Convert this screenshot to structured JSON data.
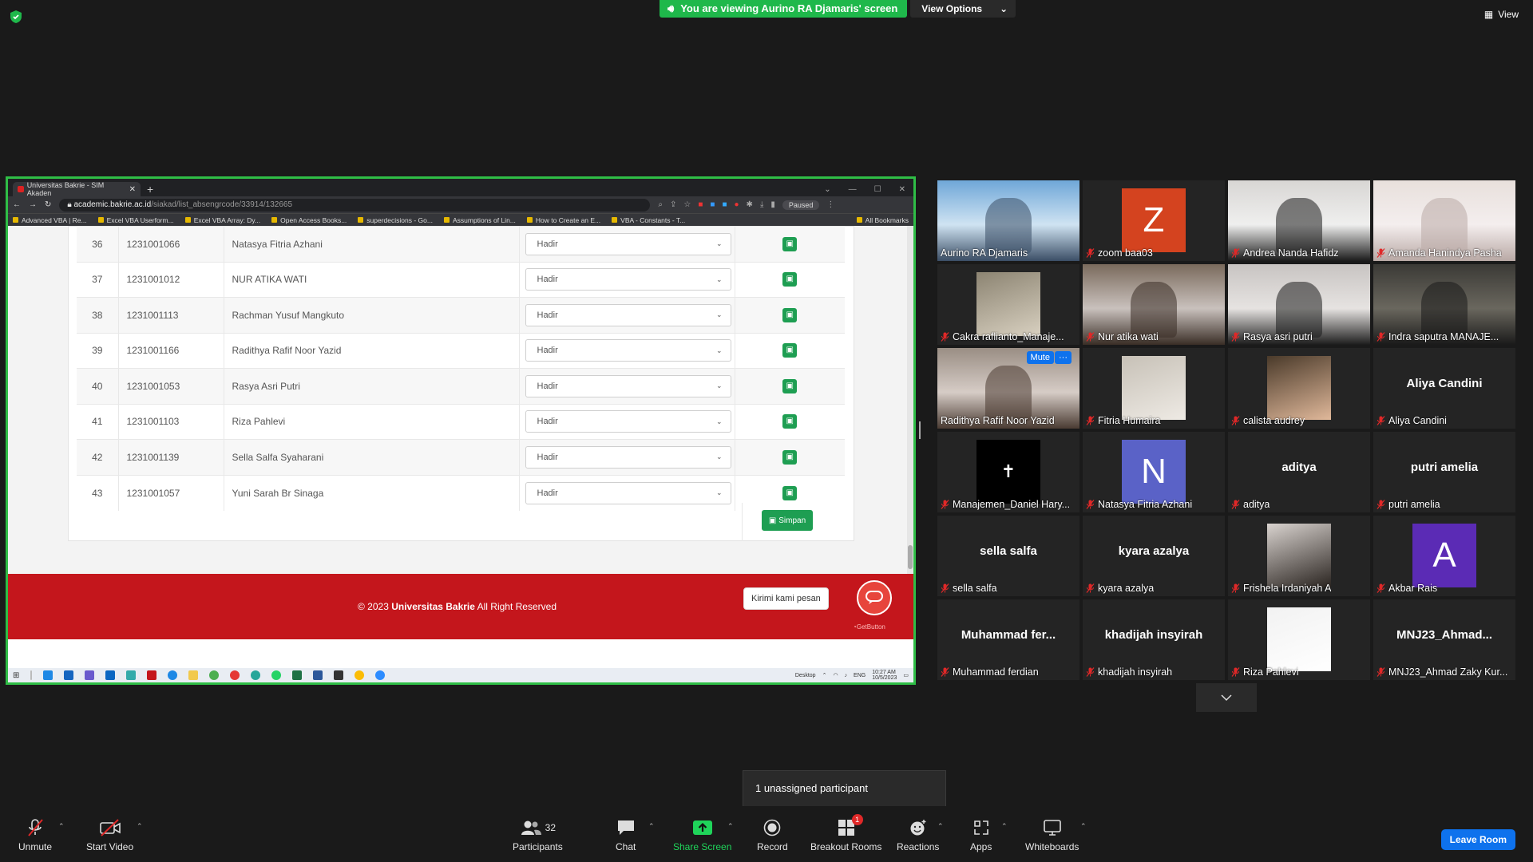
{
  "banner": {
    "viewing_text": "You are viewing Aurino RA Djamaris' screen",
    "view_options": "View Options",
    "view_label": "View"
  },
  "browser": {
    "tab_title": "Universitas Bakrie - SIM Akaden",
    "url_host": "academic.bakrie.ac.id",
    "url_path": "/siakad/list_absengrcode/33914/132665",
    "profile_status": "Paused",
    "bookmarks": [
      "Advanced VBA | Re...",
      "Excel VBA Userform...",
      "Excel VBA Array: Dy...",
      "Open Access Books...",
      "superdecisions - Go...",
      "Assumptions of Lin...",
      "How to Create an E...",
      "VBA - Constants - T..."
    ],
    "all_bookmarks": "All Bookmarks"
  },
  "attendance": {
    "rows": [
      {
        "no": "36",
        "nim": "1231001066",
        "name": "Natasya Fitria Azhani",
        "status": "Hadir"
      },
      {
        "no": "37",
        "nim": "1231001012",
        "name": "NUR ATIKA WATI",
        "status": "Hadir"
      },
      {
        "no": "38",
        "nim": "1231001113",
        "name": "Rachman Yusuf Mangkuto",
        "status": "Hadir"
      },
      {
        "no": "39",
        "nim": "1231001166",
        "name": "Radithya Rafif Noor Yazid",
        "status": "Hadir"
      },
      {
        "no": "40",
        "nim": "1231001053",
        "name": "Rasya Asri Putri",
        "status": "Hadir"
      },
      {
        "no": "41",
        "nim": "1231001103",
        "name": "Riza Pahlevi",
        "status": "Hadir"
      },
      {
        "no": "42",
        "nim": "1231001139",
        "name": "Sella Salfa Syaharani",
        "status": "Hadir"
      },
      {
        "no": "43",
        "nim": "1231001057",
        "name": "Yuni Sarah Br Sinaga",
        "status": "Hadir"
      }
    ],
    "save_all": "Simpan"
  },
  "footer": {
    "copyright_prefix": "© 2023",
    "university": "Universitas Bakrie",
    "rights": "All Right Reserved",
    "chat_prompt": "Kirimi kami pesan",
    "getbutton": "GetButton"
  },
  "taskbar": {
    "desktop": "Desktop",
    "lang": "ENG",
    "time": "10:27 AM",
    "date": "10/5/2023"
  },
  "participants": [
    {
      "name": "Aurino RA Djamaris",
      "kind": "photo",
      "colors": [
        "#6fa7d8",
        "#cfe3f2",
        "#3b4e66"
      ],
      "active": true,
      "muted": false
    },
    {
      "name": "zoom baa03",
      "kind": "letter",
      "letter": "Z",
      "color": "#d4431f",
      "muted": true
    },
    {
      "name": "Andrea Nanda Hafidz",
      "kind": "photo",
      "colors": [
        "#d8d6d4",
        "#efefee",
        "#1b1b1b"
      ],
      "muted": true
    },
    {
      "name": "Amanda Hanindya Pasha",
      "kind": "photo",
      "colors": [
        "#e8e0dc",
        "#f4eeee",
        "#b9a9a5"
      ],
      "muted": true
    },
    {
      "name": "Cakra raflianto_Manaje...",
      "kind": "small",
      "colors": [
        "#8c8472",
        "#d8d0c0"
      ],
      "muted": true
    },
    {
      "name": "Nur atika wati",
      "kind": "photo",
      "colors": [
        "#7a6a5c",
        "#c9c1bd",
        "#3a2e26"
      ],
      "muted": true
    },
    {
      "name": "Rasya asri putri",
      "kind": "photo",
      "colors": [
        "#c8c4c2",
        "#e6e3e1",
        "#1c1c1c"
      ],
      "muted": true
    },
    {
      "name": "Indra saputra MANAJE...",
      "kind": "photo",
      "colors": [
        "#3b3a36",
        "#6a675e",
        "#1a1a1a"
      ],
      "muted": true
    },
    {
      "name": "Radithya Rafif Noor Yazid",
      "kind": "photo",
      "colors": [
        "#9a8e84",
        "#d6ccc6",
        "#4a3b32"
      ],
      "muted": false,
      "hover": true,
      "mute_label": "Mute",
      "more_label": "···"
    },
    {
      "name": "Fitria Humaira",
      "kind": "small",
      "colors": [
        "#c7c1b7",
        "#eeeae4"
      ],
      "muted": true
    },
    {
      "name": "calista audrey",
      "kind": "small",
      "colors": [
        "#4a3a2a",
        "#e0b89a"
      ],
      "muted": true
    },
    {
      "name": "Aliya Candini",
      "kind": "text",
      "muted": true
    },
    {
      "name": "Manajemen_Daniel Hary...",
      "kind": "cross",
      "muted": true
    },
    {
      "name": "Natasya Fitria Azhani",
      "kind": "letter",
      "letter": "N",
      "color": "#5a62c7",
      "muted": true
    },
    {
      "name": "aditya",
      "kind": "text",
      "muted": true
    },
    {
      "name": "putri amelia",
      "kind": "text",
      "muted": true
    },
    {
      "name": "sella salfa",
      "kind": "text",
      "muted": true
    },
    {
      "name": "kyara azalya",
      "kind": "text",
      "muted": true
    },
    {
      "name": "Frishela Irdaniyah A",
      "kind": "small",
      "colors": [
        "#d9d3cf",
        "#2a2420"
      ],
      "muted": true
    },
    {
      "name": "Akbar Rais",
      "kind": "letter",
      "letter": "A",
      "color": "#5b2bb5",
      "muted": true
    },
    {
      "name": "Muhammad ferdian",
      "bigname": "Muhammad  fer...",
      "kind": "text",
      "muted": true
    },
    {
      "name": "khadijah insyirah",
      "kind": "text",
      "muted": true
    },
    {
      "name": "Riza Pahlevi",
      "kind": "small",
      "colors": [
        "#f2f2f2",
        "#ffffff"
      ],
      "muted": true
    },
    {
      "name": "MNJ23_Ahmad Zaky Kur...",
      "bigname": "MNJ23_Ahmad...",
      "kind": "text",
      "muted": true
    }
  ],
  "toast": "1 unassigned participant",
  "toolbar": {
    "unmute": "Unmute",
    "start_video": "Start Video",
    "participants": "Participants",
    "participant_count": "32",
    "chat": "Chat",
    "share_screen": "Share Screen",
    "record": "Record",
    "breakout": "Breakout Rooms",
    "breakout_badge": "1",
    "reactions": "Reactions",
    "apps": "Apps",
    "whiteboards": "Whiteboards",
    "leave": "Leave Room"
  },
  "colors": {
    "zoom_green": "#1fb84b",
    "zoom_blue": "#0e72ed",
    "active_speaker": "#f5d90a",
    "footer_red": "#c4161c",
    "save_green": "#1e9e52"
  }
}
